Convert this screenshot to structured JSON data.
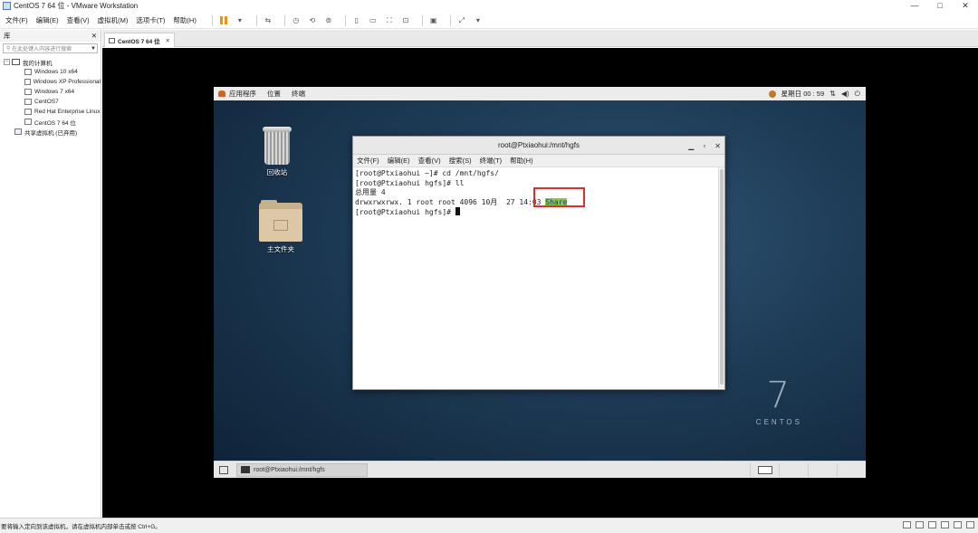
{
  "window": {
    "title": "CentOS 7 64 位 - VMware Workstation"
  },
  "menu": [
    "文件(F)",
    "编辑(E)",
    "查看(V)",
    "虚拟机(M)",
    "选项卡(T)",
    "帮助(H)"
  ],
  "library": {
    "title": "库",
    "search_placeholder": "在此处键入内容进行搜索",
    "root": "我的计算机",
    "vms": [
      "Windows 10 x64",
      "Windows XP Professional",
      "Windows 7 x64",
      "CentOS7",
      "Red Hat Enterprise Linux",
      "CentOS 7 64 位"
    ],
    "shared": "共享虚拟机 (已弃用)"
  },
  "tab": {
    "label": "CentOS 7 64 位"
  },
  "guest": {
    "topbar": {
      "applications": "应用程序",
      "places": "位置",
      "terminal": "终端",
      "clock": "星期日 00 : 59"
    },
    "desktop": {
      "trash": "回收站",
      "home": "主文件夹"
    },
    "logo": {
      "number": "7",
      "word": "CENTOS"
    },
    "terminal": {
      "title": "root@Ptxiaohui:/mnt/hgfs",
      "menu": [
        "文件(F)",
        "编辑(E)",
        "查看(V)",
        "搜索(S)",
        "终端(T)",
        "帮助(H)"
      ],
      "lines": [
        "[root@Ptxiaohui ~]# cd /mnt/hgfs/",
        "[root@Ptxiaohui hgfs]# ll",
        "总用量 4"
      ],
      "ls_prefix": "drwxrwxrwx. 1 root root 4096 10月  27 14:03 ",
      "ls_name": "Share",
      "prompt": "[root@Ptxiaohui hgfs]# "
    },
    "taskbar": {
      "item": "root@Ptxiaohui:/mnt/hgfs"
    }
  },
  "status": {
    "text": "要将输入定向到该虚拟机，请在虚拟机内部单击或按 Ctrl+G。"
  }
}
